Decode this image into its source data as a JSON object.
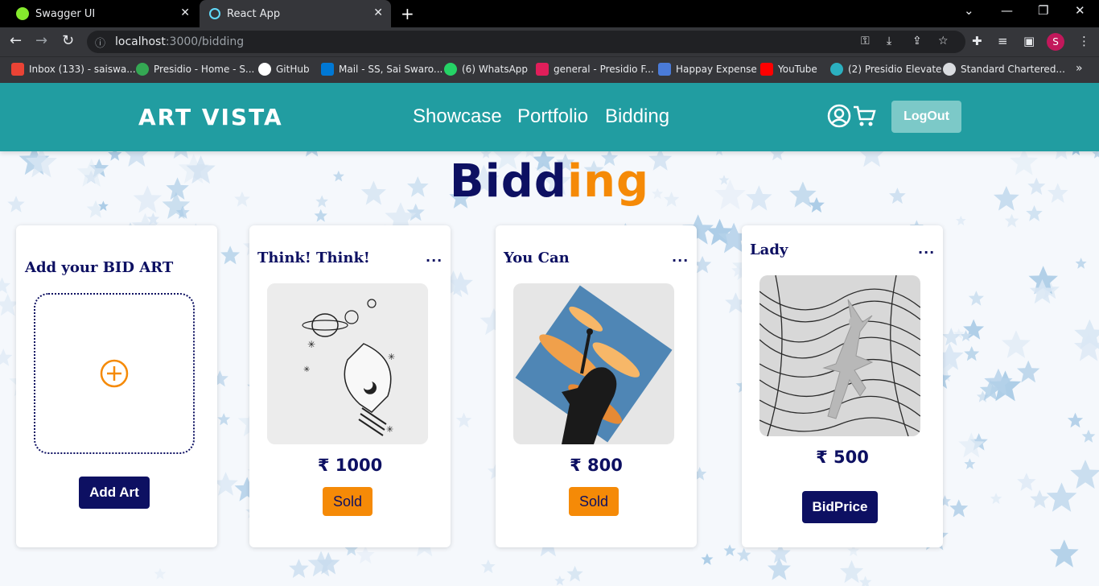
{
  "browser": {
    "tabs": [
      {
        "title": "Swagger UI",
        "favicon": "swagger-icon"
      },
      {
        "title": "React App",
        "favicon": "react-icon"
      }
    ],
    "url_host": "localhost",
    "url_path": ":3000/bidding",
    "profile_initial": "S",
    "bookmarks": [
      {
        "label": "Inbox (133) - saiswa...",
        "icon": "gmail-icon"
      },
      {
        "label": "Presidio - Home - S...",
        "icon": "presidio-icon"
      },
      {
        "label": "GitHub",
        "icon": "github-icon"
      },
      {
        "label": "Mail - SS, Sai Swaro...",
        "icon": "outlook-icon"
      },
      {
        "label": "(6) WhatsApp",
        "icon": "whatsapp-icon"
      },
      {
        "label": "general - Presidio F...",
        "icon": "slack-icon"
      },
      {
        "label": "Happay Expense",
        "icon": "happay-icon"
      },
      {
        "label": "YouTube",
        "icon": "youtube-icon"
      },
      {
        "label": "(2) Presidio Elevate",
        "icon": "elevate-icon"
      },
      {
        "label": "Standard Chartered...",
        "icon": "globe-icon"
      }
    ]
  },
  "header": {
    "logo": "ART VISTA",
    "nav": [
      "Showcase",
      "Portfolio",
      "Bidding"
    ],
    "logout_label": "LogOut",
    "accent": "#219da1"
  },
  "page": {
    "title_part1": "Bidd",
    "title_part2": "ing",
    "title_colors": [
      "#0d1062",
      "#f58a07"
    ]
  },
  "add_card": {
    "title": "Add your BID ART",
    "button": "Add Art"
  },
  "artworks": [
    {
      "title": "Think! Think!",
      "menu": "...",
      "price": "₹ 1000",
      "action": "Sold",
      "status": "sold"
    },
    {
      "title": "You Can",
      "menu": "...",
      "price": "₹ 800",
      "action": "Sold",
      "status": "sold"
    },
    {
      "title": "Lady",
      "menu": "...",
      "price": "₹ 500",
      "action": "BidPrice",
      "status": "open"
    }
  ]
}
